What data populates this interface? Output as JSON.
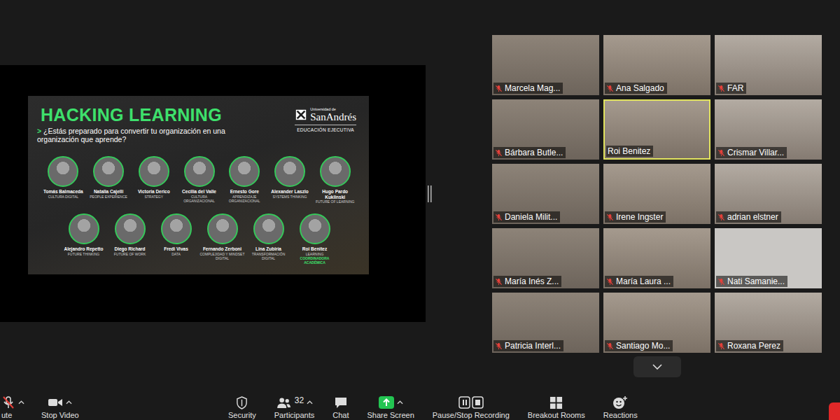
{
  "share": {
    "slide": {
      "title": "HACKING LEARNING",
      "marker": ">",
      "subtitle": "¿Estás preparado para convertir tu organización en una organización que aprende?",
      "logo": {
        "small": "Universidad de",
        "name": "SanAndrés",
        "unit": "EDUCACIÓN EJECUTIVA"
      },
      "rows": [
        [
          {
            "name": "Tomás Balmaceda",
            "role": "CULTURA DIGITAL"
          },
          {
            "name": "Natalia Cajelli",
            "role": "PEOPLE EXPERIENCE"
          },
          {
            "name": "Victoria Derico",
            "role": "STRATEGY"
          },
          {
            "name": "Cecilia del Valle",
            "role": "CULTURA ORGANIZACIONAL"
          },
          {
            "name": "Ernesto Gore",
            "role": "APRENDIZAJE ORGANIZACIONAL"
          },
          {
            "name": "Alexander Laszlo",
            "role": "SYSTEMS THINKING"
          },
          {
            "name": "Hugo Pardo Kuklinski",
            "role": "FUTURE OF LEARNING"
          }
        ],
        [
          {
            "name": "Alejandro Repetto",
            "role": "FUTURE THINKING"
          },
          {
            "name": "Diego Richard",
            "role": "FUTURE OF WORK"
          },
          {
            "name": "Fredi Vivas",
            "role": "DATA"
          },
          {
            "name": "Fernando Zerboni",
            "role": "COMPLEJIDAD Y MINDSET DIGITAL"
          },
          {
            "name": "Lina Zubiría",
            "role": "TRANSFORMACIÓN DIGITAL"
          },
          {
            "name": "Roi Benitez",
            "role": "LEARNING",
            "note": "COORDINADORA ACADÉMICA"
          }
        ]
      ]
    }
  },
  "gallery": {
    "tiles": [
      {
        "name": "Marcela Mag...",
        "muted": true,
        "speaking": false
      },
      {
        "name": "Ana Salgado",
        "muted": true,
        "speaking": false
      },
      {
        "name": "FAR",
        "muted": true,
        "speaking": false
      },
      {
        "name": "Bárbara Butle...",
        "muted": true,
        "speaking": false
      },
      {
        "name": "Roi Benitez",
        "muted": false,
        "speaking": true
      },
      {
        "name": "Crismar Villar...",
        "muted": true,
        "speaking": false
      },
      {
        "name": "Daniela Milit...",
        "muted": true,
        "speaking": false
      },
      {
        "name": "Irene Ingster",
        "muted": true,
        "speaking": false
      },
      {
        "name": "adrian elstner",
        "muted": true,
        "speaking": false
      },
      {
        "name": "María Inés Z...",
        "muted": true,
        "speaking": false
      },
      {
        "name": "María Laura ...",
        "muted": true,
        "speaking": false
      },
      {
        "name": "Nati Samanie...",
        "muted": true,
        "speaking": false
      },
      {
        "name": "Patricia Interl...",
        "muted": true,
        "speaking": false
      },
      {
        "name": "Santiago Mo...",
        "muted": true,
        "speaking": false
      },
      {
        "name": "Roxana Perez",
        "muted": true,
        "speaking": false
      }
    ]
  },
  "toolbar": {
    "mute": {
      "label": "ute",
      "menu": true
    },
    "video": {
      "label": "Stop Video",
      "menu": true
    },
    "security": {
      "label": "Security",
      "menu": false
    },
    "participants": {
      "label": "Participants",
      "count": "32",
      "menu": true
    },
    "chat": {
      "label": "Chat",
      "menu": false
    },
    "share": {
      "label": "Share Screen",
      "menu": true
    },
    "record": {
      "label": "Pause/Stop Recording",
      "menu": false
    },
    "breakout": {
      "label": "Breakout Rooms",
      "menu": false
    },
    "reactions": {
      "label": "Reactions",
      "menu": false
    }
  }
}
